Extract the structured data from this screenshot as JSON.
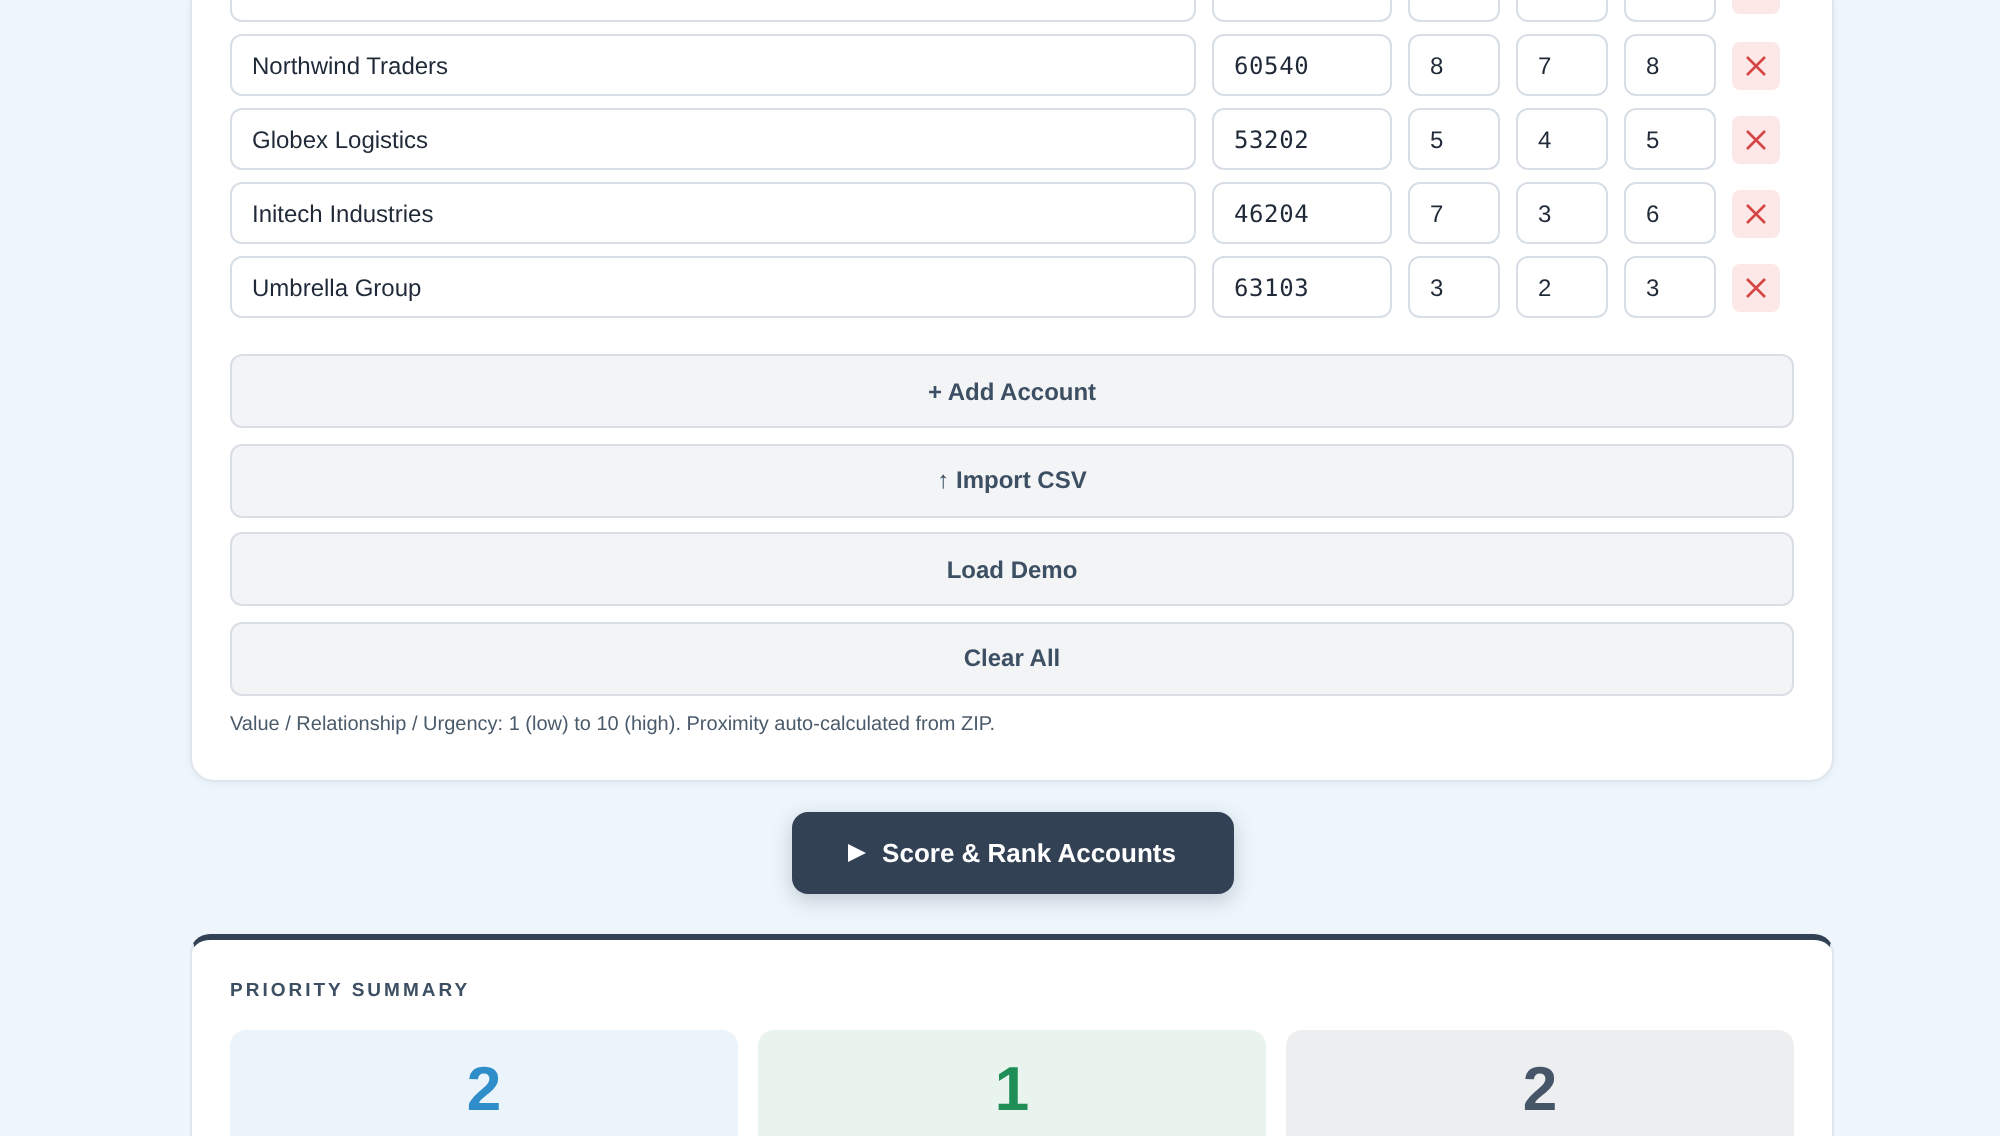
{
  "accounts": [
    {
      "clipped": true
    },
    {
      "clipped": false,
      "name": "Northwind Traders",
      "zip": "60540",
      "value": "8",
      "relationship": "7",
      "urgency": "8"
    },
    {
      "clipped": false,
      "name": "Globex Logistics",
      "zip": "53202",
      "value": "5",
      "relationship": "4",
      "urgency": "5"
    },
    {
      "clipped": false,
      "name": "Initech Industries",
      "zip": "46204",
      "value": "7",
      "relationship": "3",
      "urgency": "6"
    },
    {
      "clipped": false,
      "name": "Umbrella Group",
      "zip": "63103",
      "value": "3",
      "relationship": "2",
      "urgency": "3"
    }
  ],
  "actions": [
    "+ Add Account",
    "↑ Import CSV",
    "Load Demo",
    "Clear All"
  ],
  "hint": "Value / Relationship / Urgency: 1 (low) to 10 (high). Proximity auto-calculated from ZIP.",
  "score_button": {
    "label": "Score & Rank Accounts"
  },
  "summary": {
    "title": "PRIORITY SUMMARY",
    "tiers": [
      {
        "count": "2",
        "color": "#2f8ec9"
      },
      {
        "count": "1",
        "color": "#1f8f57"
      },
      {
        "count": "2",
        "color": "#475569"
      }
    ]
  }
}
